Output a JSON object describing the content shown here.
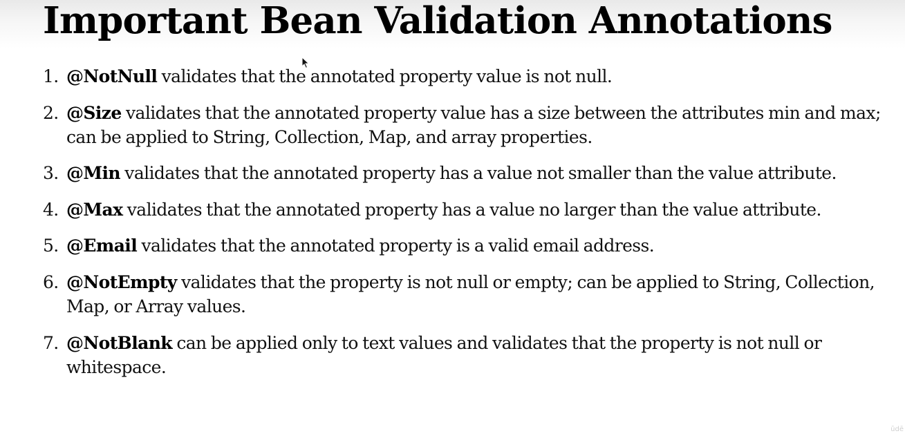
{
  "slide": {
    "title": "Important Bean Validation Annotations"
  },
  "items": [
    {
      "number": "1.",
      "annotation": "@NotNull",
      "text": " validates that the annotated property value is not null."
    },
    {
      "number": "2.",
      "annotation": "@Size",
      "text": " validates that the annotated property value has a size between the attributes min and max; can be applied to String, Collection, Map, and array properties."
    },
    {
      "number": "3.",
      "annotation": "@Min",
      "text": " validates that the annotated property has a value not smaller than the value attribute."
    },
    {
      "number": "4.",
      "annotation": "@Max",
      "text": " validates that the annotated property has a value no larger than the value attribute."
    },
    {
      "number": "5.",
      "annotation": "@Email",
      "text": " validates that the annotated property is a valid email address."
    },
    {
      "number": "6.",
      "annotation": "@NotEmpty",
      "text": " validates that the property is not null or empty; can be applied to String, Collection, Map, or Array values."
    },
    {
      "number": "7.",
      "annotation": "@NotBlank",
      "text": " can be applied only to text values and validates that the property is not null or whitespace."
    }
  ],
  "icons": {
    "cursor": "mouse-pointer-icon"
  },
  "watermark": {
    "text": "ūdē"
  }
}
